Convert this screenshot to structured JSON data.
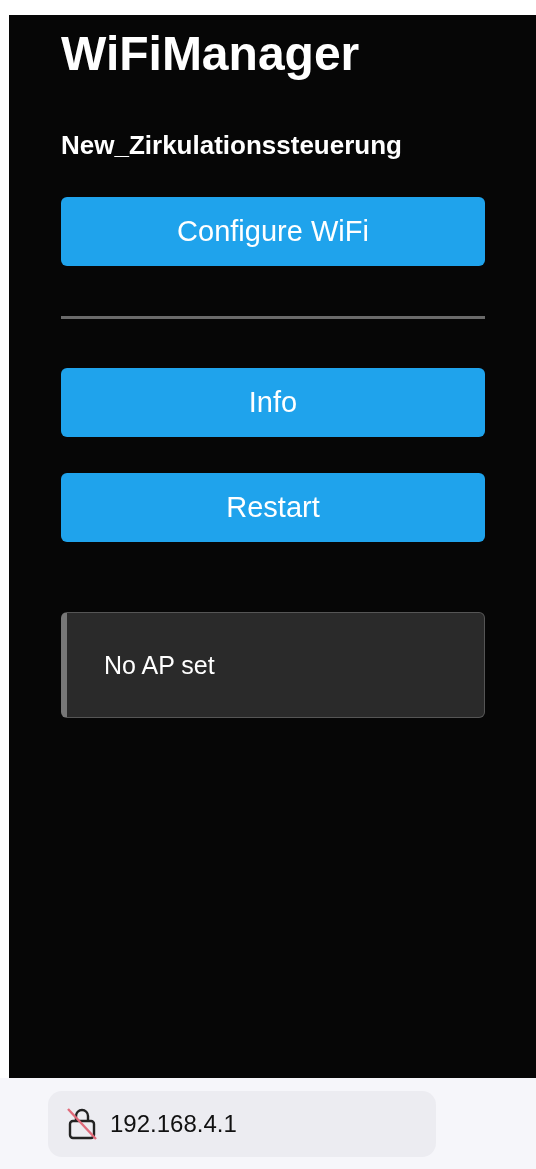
{
  "title": "WiFiManager",
  "subtitle": "New_Zirkulationssteuerung",
  "buttons": [
    {
      "label": "Configure WiFi",
      "kind": "button"
    },
    {
      "kind": "divider"
    },
    {
      "label": "Info",
      "kind": "button"
    },
    {
      "label": "Restart",
      "kind": "button"
    }
  ],
  "message": "No AP set",
  "address_bar": {
    "url": "192.168.4.1",
    "secure": false
  }
}
